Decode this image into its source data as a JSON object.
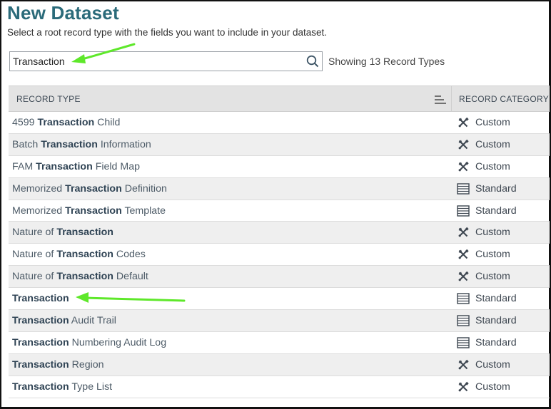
{
  "header": {
    "title": "New Dataset",
    "subtitle": "Select a root record type with the fields you want to include in your dataset."
  },
  "search": {
    "value": "Transaction",
    "icon": "search-icon",
    "result_count_text": "Showing 13 Record Types"
  },
  "table": {
    "columns": [
      "RECORD TYPE",
      "RECORD CATEGORY"
    ],
    "rows": [
      {
        "pre": "4599 ",
        "match": "Transaction",
        "post": " Child",
        "category": "Custom",
        "icon": "tools-icon"
      },
      {
        "pre": "Batch ",
        "match": "Transaction",
        "post": " Information",
        "category": "Custom",
        "icon": "tools-icon"
      },
      {
        "pre": "FAM ",
        "match": "Transaction",
        "post": " Field Map",
        "category": "Custom",
        "icon": "tools-icon"
      },
      {
        "pre": "Memorized ",
        "match": "Transaction",
        "post": " Definition",
        "category": "Standard",
        "icon": "record-list-icon"
      },
      {
        "pre": "Memorized ",
        "match": "Transaction",
        "post": " Template",
        "category": "Standard",
        "icon": "record-list-icon"
      },
      {
        "pre": "Nature of ",
        "match": "Transaction",
        "post": "",
        "category": "Custom",
        "icon": "tools-icon"
      },
      {
        "pre": "Nature of ",
        "match": "Transaction",
        "post": " Codes",
        "category": "Custom",
        "icon": "tools-icon"
      },
      {
        "pre": "Nature of ",
        "match": "Transaction",
        "post": " Default",
        "category": "Custom",
        "icon": "tools-icon"
      },
      {
        "pre": "",
        "match": "Transaction",
        "post": "",
        "category": "Standard",
        "icon": "record-list-icon"
      },
      {
        "pre": "",
        "match": "Transaction",
        "post": " Audit Trail",
        "category": "Standard",
        "icon": "record-list-icon"
      },
      {
        "pre": "",
        "match": "Transaction",
        "post": " Numbering Audit Log",
        "category": "Standard",
        "icon": "record-list-icon"
      },
      {
        "pre": "",
        "match": "Transaction",
        "post": " Region",
        "category": "Custom",
        "icon": "tools-icon"
      },
      {
        "pre": "",
        "match": "Transaction",
        "post": " Type List",
        "category": "Custom",
        "icon": "tools-icon"
      }
    ]
  },
  "colors": {
    "title": "#2b6b7a",
    "annotation_arrow": "#5ee82a",
    "header_bg": "#e3e3e3",
    "alt_row_bg": "#efefef"
  }
}
